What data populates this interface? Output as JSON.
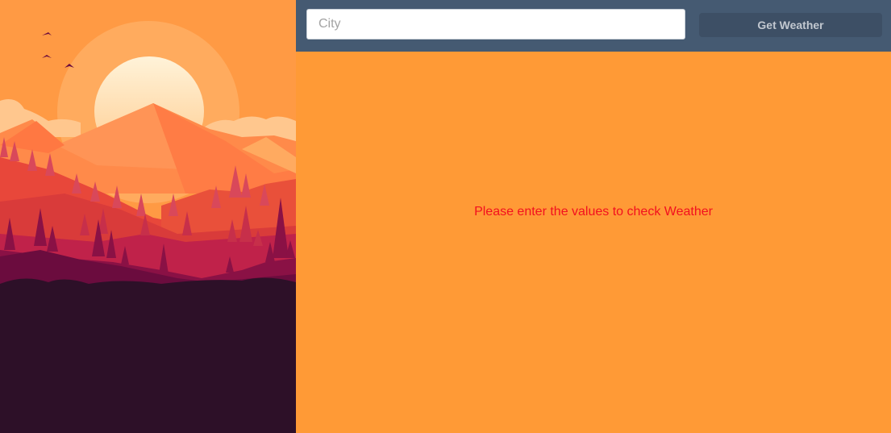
{
  "search": {
    "placeholder": "City",
    "value": ""
  },
  "actions": {
    "get_weather_label": "Get Weather"
  },
  "status": {
    "message": "Please enter the values to check Weather"
  },
  "colors": {
    "toolbar_bg": "#455a72",
    "content_bg": "#ff9a36",
    "button_bg": "#3d4f65",
    "message_text": "#f2101f",
    "ground": "#2d1028"
  }
}
